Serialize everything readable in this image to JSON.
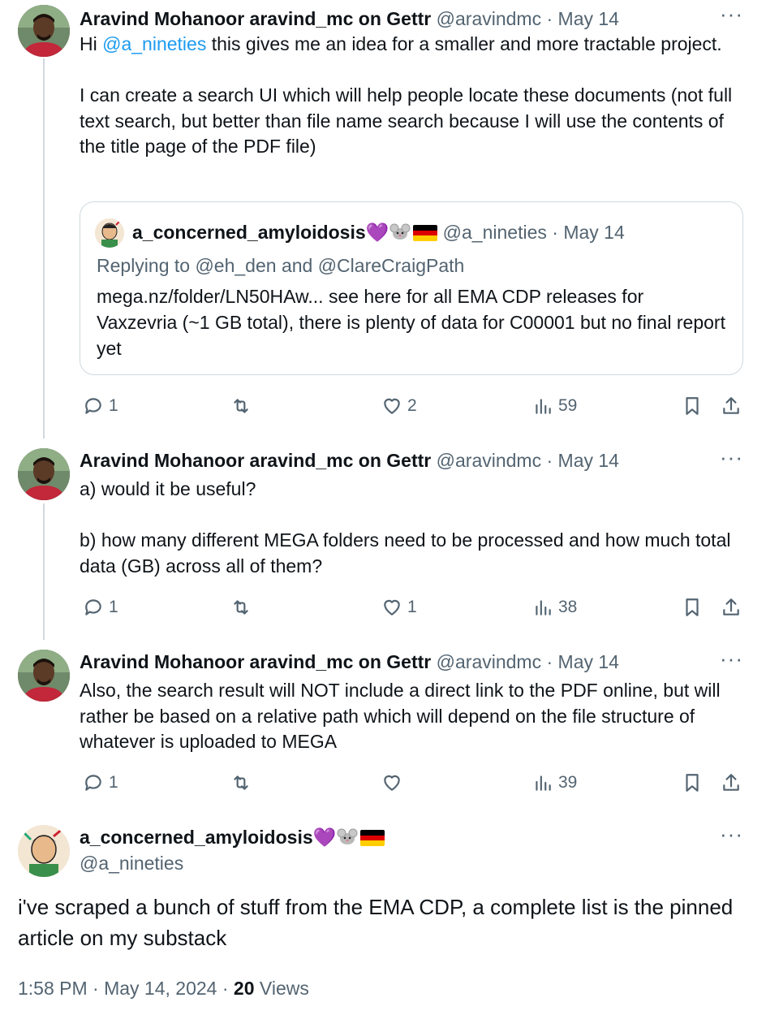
{
  "tweets": [
    {
      "name": "Aravind Mohanoor aravind_mc on Gettr",
      "handle": "@aravindmc",
      "date": "May 14",
      "body_pre": "Hi ",
      "mention": "@a_nineties",
      "body_post": " this gives me an idea for a smaller and more tractable project.",
      "body_p2": "I can create a search UI which will help people locate these documents (not full text search, but better than file name search because I will use the contents of the title page of the PDF file)",
      "quote": {
        "name": "a_concerned_amyloidosis",
        "handle": "@a_nineties",
        "date": "May 14",
        "replying": "Replying to @eh_den and @ClareCraigPath",
        "body": "mega.nz/folder/LN50HAw... see here for all EMA CDP releases for Vaxzevria (~1 GB total), there is plenty of data for C00001 but no final report yet"
      },
      "stats": {
        "replies": "1",
        "likes": "2",
        "views": "59"
      }
    },
    {
      "name": "Aravind Mohanoor aravind_mc on Gettr",
      "handle": "@aravindmc",
      "date": "May 14",
      "body_p1": "a) would it be useful?",
      "body_p2": "b) how many different MEGA folders need to be processed and how much total data (GB) across all of them?",
      "stats": {
        "replies": "1",
        "likes": "1",
        "views": "38"
      }
    },
    {
      "name": "Aravind Mohanoor aravind_mc on Gettr",
      "handle": "@aravindmc",
      "date": "May 14",
      "body_p1": "Also, the search result will NOT include a direct link to the PDF online, but will rather be based on a relative path which will depend on the file structure of whatever is uploaded to MEGA",
      "stats": {
        "replies": "1",
        "likes": "",
        "views": "39"
      }
    }
  ],
  "main": {
    "name": "a_concerned_amyloidosis",
    "handle": "@a_nineties",
    "body": "i've scraped a bunch of stuff from the EMA CDP, a complete list is the pinned article on my substack",
    "time": "1:58 PM · May 14, 2024",
    "views_count": "20",
    "views_label": " Views"
  },
  "ui": {
    "dot": " · ",
    "more": "···",
    "emoji_heart": "💜"
  },
  "colors": {
    "accent": "#1d9bf0",
    "muted": "#536471",
    "border": "#cfd9de"
  }
}
